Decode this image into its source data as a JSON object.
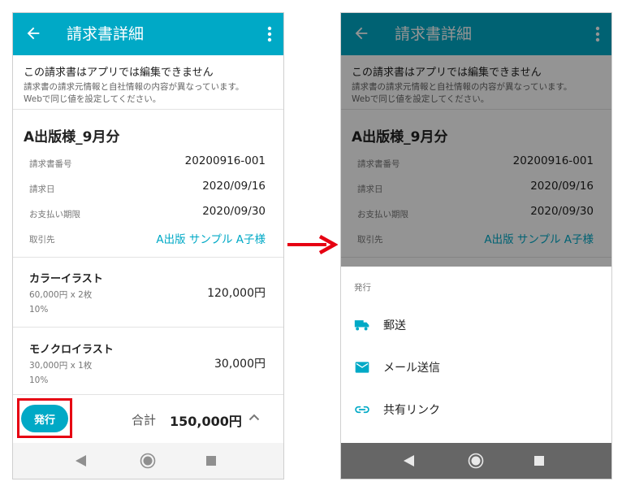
{
  "header": {
    "title": "請求書詳細"
  },
  "notice": {
    "heading": "この請求書はアプリでは編集できません",
    "line1": "請求書の請求元情報と自社情報の内容が異なっています。",
    "line2": "Webで同じ値を設定してください。"
  },
  "invoice": {
    "title": "A出版様_9月分",
    "fields": [
      {
        "label": "請求書番号",
        "value": "20200916-001"
      },
      {
        "label": "請求日",
        "value": "2020/09/16"
      },
      {
        "label": "お支払い期限",
        "value": "2020/09/30"
      },
      {
        "label": "取引先",
        "value": "A出版 サンプル A子様"
      }
    ],
    "items": [
      {
        "name": "カラーイラスト",
        "qty": "60,000円 x 2枚",
        "tax": "10%",
        "amount": "120,000円"
      },
      {
        "name": "モノクロイラスト",
        "qty": "30,000円 x 1枚",
        "tax": "10%",
        "amount": "30,000円"
      }
    ]
  },
  "footer": {
    "issue_label": "発行",
    "total_label": "合計",
    "total_value": "150,000円"
  },
  "sheet": {
    "title": "発行",
    "options": [
      {
        "label": "郵送",
        "icon": "truck-icon"
      },
      {
        "label": "メール送信",
        "icon": "mail-icon"
      },
      {
        "label": "共有リンク",
        "icon": "link-icon"
      }
    ]
  },
  "colors": {
    "accent": "#00a9c6",
    "highlight": "#e60012",
    "arrow": "#e60012"
  }
}
